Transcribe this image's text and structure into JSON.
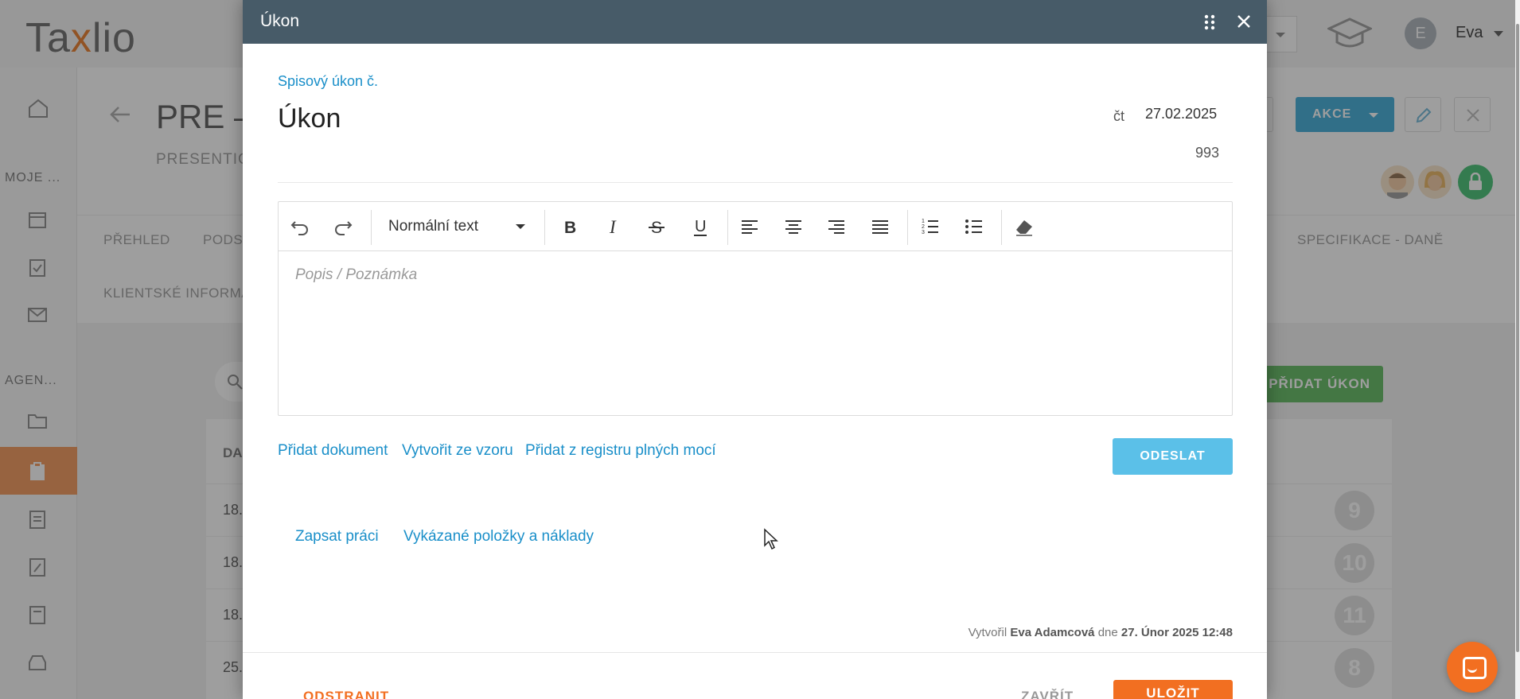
{
  "app": {
    "logo_pre": "Ta",
    "logo_x": "x",
    "logo_post": "lio",
    "user_initial": "E",
    "user_name": "Eva"
  },
  "sidebar": {
    "section_moje": "MOJE ...",
    "section_agen": "AGEN..."
  },
  "page": {
    "title": "PRE —",
    "subtitle": "PRESENTIGO",
    "akce_label": "AKCE",
    "tabs": [
      "PŘEHLED",
      "PODSI",
      "SPECIFIKACE - DANĚ",
      "KLIENTSKÉ INFORMACE"
    ],
    "add_ukon_label": "PŘIDAT ÚKON",
    "table_header": "DA",
    "rows": [
      {
        "date": "18.",
        "count": "9"
      },
      {
        "date": "18.",
        "count": "10"
      },
      {
        "date": "18.",
        "count": "11"
      },
      {
        "date": "25.",
        "count": "8"
      }
    ]
  },
  "modal": {
    "title": "Úkon",
    "file_link": "Spisový úkon č.",
    "heading": "Úkon",
    "day": "čt",
    "date": "27.02.2025",
    "code": "993",
    "editor": {
      "format": "Normální text",
      "placeholder": "Popis / Poznámka"
    },
    "links": {
      "add_document": "Přidat dokument",
      "from_template": "Vytvořit ze vzoru",
      "from_registry": "Přidat z registru plných mocí",
      "log_work": "Zapsat práci",
      "items_costs": "Vykázané položky a náklady"
    },
    "send_label": "ODESLAT",
    "created_prefix": "Vytvořil",
    "created_by": "Eva Adamcová",
    "created_mid": "dne",
    "created_at": "27. Únor 2025 12:48",
    "delete_label": "ODSTRANIT",
    "close_label": "ZAVŘÍT",
    "save_label": "ULOŽIT"
  },
  "colors": {
    "header": "#475b68",
    "link": "#1a8fc9",
    "accent": "#f26f21",
    "send": "#5bc0e8"
  }
}
